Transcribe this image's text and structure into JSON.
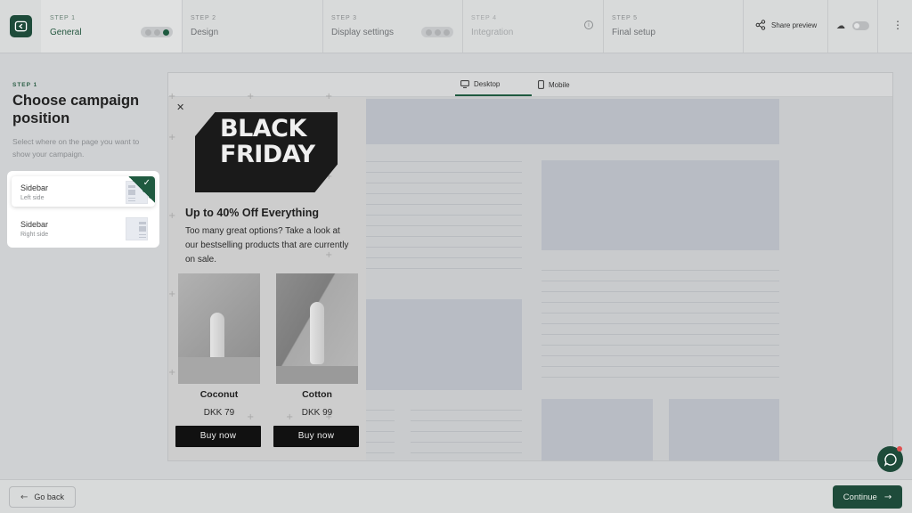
{
  "header": {
    "steps": [
      {
        "num": "STEP 1",
        "label": "General",
        "state": "active"
      },
      {
        "num": "STEP 2",
        "label": "Design",
        "state": "normal"
      },
      {
        "num": "STEP 3",
        "label": "Display settings",
        "state": "normal"
      },
      {
        "num": "STEP 4",
        "label": "Integration",
        "state": "disabled"
      },
      {
        "num": "STEP 5",
        "label": "Final setup",
        "state": "normal"
      }
    ],
    "share_label": "Share preview"
  },
  "left": {
    "eyebrow": "STEP 1",
    "title": "Choose campaign position",
    "description": "Select where on the page you want to show your campaign.",
    "options": [
      {
        "title": "Sidebar",
        "subtitle": "Left side",
        "selected": true
      },
      {
        "title": "Sidebar",
        "subtitle": "Right side",
        "selected": false
      }
    ]
  },
  "preview": {
    "tabs": [
      {
        "label": "Desktop",
        "icon": "desktop-icon"
      },
      {
        "label": "Mobile",
        "icon": "mobile-icon"
      }
    ],
    "campaign": {
      "headline_line1": "BLACK",
      "headline_line2": "FRIDAY",
      "offer": "Up to 40% Off Everything",
      "body": "Too many great options? Take a look at our bestselling products that are currently on sale.",
      "products": [
        {
          "name": "Coconut",
          "price": "DKK 79",
          "cta": "Buy now"
        },
        {
          "name": "Cotton",
          "price": "DKK 99",
          "cta": "Buy now"
        }
      ]
    }
  },
  "footer": {
    "back_label": "Go back",
    "continue_label": "Continue"
  },
  "colors": {
    "brand": "#1e4b3a",
    "accent": "#1f5a40"
  }
}
